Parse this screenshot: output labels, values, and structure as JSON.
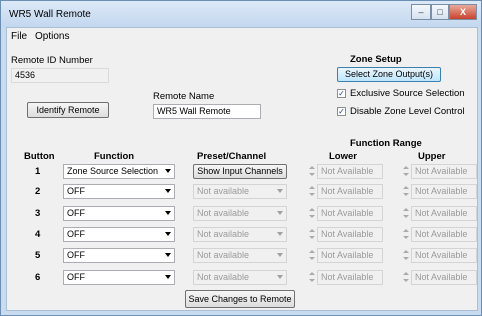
{
  "window": {
    "title": "WR5 Wall Remote",
    "minimize": "–",
    "maximize": "□",
    "close": "X"
  },
  "menu": [
    "File",
    "Options"
  ],
  "remote_id": {
    "label": "Remote ID Number",
    "value": "4536"
  },
  "identify_button": "Identify Remote",
  "remote_name": {
    "label": "Remote Name",
    "value": "WR5 Wall Remote"
  },
  "zone_setup": {
    "title": "Zone Setup",
    "button": "Select Zone Output(s)",
    "exclusive": {
      "label": "Exclusive Source Selection",
      "checked": true
    },
    "disable_level": {
      "label": "Disable Zone Level Control",
      "checked": true
    }
  },
  "headers": {
    "button": "Button",
    "function": "Function",
    "preset": "Preset/Channel",
    "range": "Function Range",
    "lower": "Lower",
    "upper": "Upper"
  },
  "rows": [
    {
      "num": "1",
      "function": "Zone Source Selection",
      "preset": "Show Input Channels",
      "preset_is_button": true,
      "lower": "Not Available",
      "upper": "Not Available"
    },
    {
      "num": "2",
      "function": "OFF",
      "preset": "Not available",
      "preset_is_button": false,
      "lower": "Not Available",
      "upper": "Not Available"
    },
    {
      "num": "3",
      "function": "OFF",
      "preset": "Not available",
      "preset_is_button": false,
      "lower": "Not Available",
      "upper": "Not Available"
    },
    {
      "num": "4",
      "function": "OFF",
      "preset": "Not available",
      "preset_is_button": false,
      "lower": "Not Available",
      "upper": "Not Available"
    },
    {
      "num": "5",
      "function": "OFF",
      "preset": "Not available",
      "preset_is_button": false,
      "lower": "Not Available",
      "upper": "Not Available"
    },
    {
      "num": "6",
      "function": "OFF",
      "preset": "Not available",
      "preset_is_button": false,
      "lower": "Not Available",
      "upper": "Not Available"
    }
  ],
  "save_button": "Save Changes to Remote"
}
